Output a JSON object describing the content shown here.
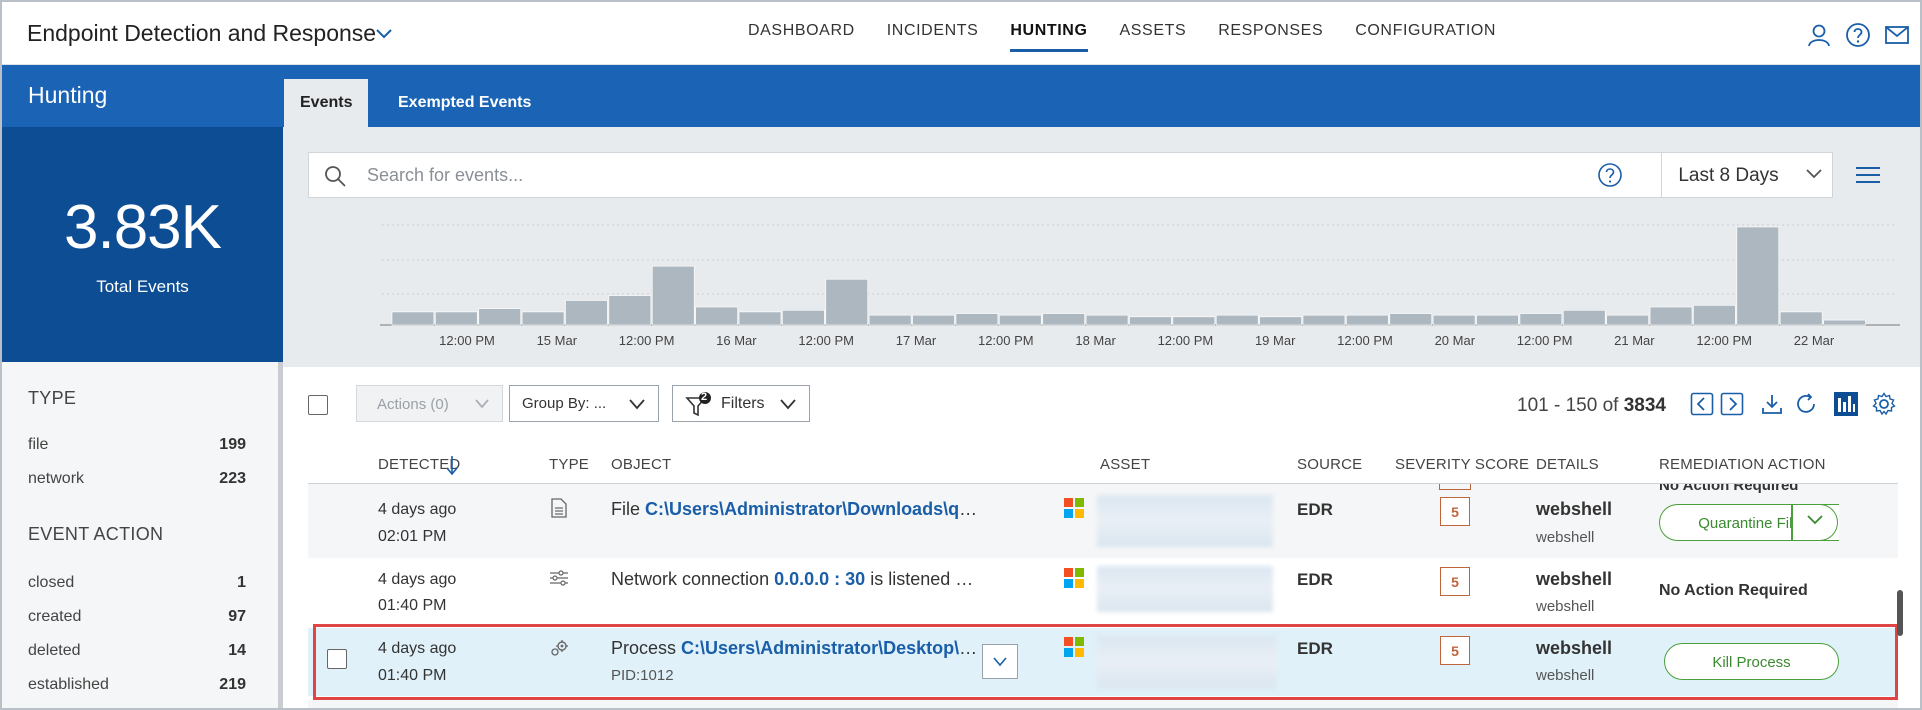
{
  "app": {
    "title": "Endpoint Detection and Response"
  },
  "topnav": [
    {
      "label": "DASHBOARD"
    },
    {
      "label": "INCIDENTS"
    },
    {
      "label": "HUNTING",
      "active": true
    },
    {
      "label": "ASSETS"
    },
    {
      "label": "RESPONSES"
    },
    {
      "label": "CONFIGURATION"
    }
  ],
  "sidebar": {
    "title": "Hunting",
    "total_value": "3.83K",
    "total_label": "Total Events",
    "type_heading": "TYPE",
    "types": [
      {
        "label": "file",
        "count": "199"
      },
      {
        "label": "network",
        "count": "223"
      }
    ],
    "event_action_heading": "EVENT ACTION",
    "event_actions": [
      {
        "label": "closed",
        "count": "1"
      },
      {
        "label": "created",
        "count": "97"
      },
      {
        "label": "deleted",
        "count": "14"
      },
      {
        "label": "established",
        "count": "219"
      }
    ]
  },
  "tabs": [
    {
      "label": "Events",
      "active": true
    },
    {
      "label": "Exempted Events"
    }
  ],
  "search": {
    "placeholder": "Search for events...",
    "value": ""
  },
  "date_range": {
    "selected": "Last 8 Days"
  },
  "histogram": {
    "values": [
      8,
      8,
      10,
      8,
      15,
      18,
      36,
      11,
      8,
      9,
      28,
      6,
      6,
      7,
      6,
      7,
      6,
      5,
      5,
      6,
      5,
      6,
      6,
      7,
      6,
      6,
      7,
      9,
      6,
      11,
      12,
      60,
      8,
      3
    ],
    "x_labels": [
      "12:00 PM",
      "15 Mar",
      "12:00 PM",
      "16 Mar",
      "12:00 PM",
      "17 Mar",
      "12:00 PM",
      "18 Mar",
      "12:00 PM",
      "19 Mar",
      "12:00 PM",
      "20 Mar",
      "12:00 PM",
      "21 Mar",
      "12:00 PM",
      "22 Mar"
    ],
    "bar_color": "#adb7bf"
  },
  "toolbar": {
    "actions_label": "Actions (0)",
    "group_by_label": "Group By: ...",
    "filters_label": "Filters",
    "filters_badge": "2",
    "range": "101 - 150 of",
    "total": "3834"
  },
  "table": {
    "headers": {
      "detected": "DETECTED",
      "type": "TYPE",
      "object": "OBJECT",
      "asset": "ASSET",
      "source": "SOURCE",
      "severity": "SEVERITY SCORE",
      "details": "DETAILS",
      "remediation": "REMEDIATION ACTION"
    },
    "partial_top_remediation": "No Action Required",
    "rows": [
      {
        "when": "4 days ago",
        "time": "02:01 PM",
        "type_icon": "file-icon",
        "object_prefix": "File",
        "object_path": "C:\\Users\\Administrator\\Downloads\\qn…",
        "object_suffix": "",
        "source": "EDR",
        "severity": "5",
        "detail": "webshell",
        "detail_sub": "webshell",
        "remediation": "Quarantine File",
        "remediation_type": "button-with-dropdown"
      },
      {
        "when": "4 days ago",
        "time": "01:40 PM",
        "type_icon": "network-icon",
        "object_prefix": "Network connection",
        "object_path": "0.0.0.0 : 30",
        "object_suffix": "is listened …",
        "source": "EDR",
        "severity": "5",
        "detail": "webshell",
        "detail_sub": "webshell",
        "remediation": "No Action Required",
        "remediation_type": "text"
      },
      {
        "when": "4 days ago",
        "time": "01:40 PM",
        "type_icon": "process-gear-icon",
        "object_prefix": "Process",
        "object_path": "C:\\Users\\Administrator\\Desktop\\q…",
        "object_suffix": "",
        "object_sub": "PID:1012",
        "source": "EDR",
        "severity": "5",
        "detail": "webshell",
        "detail_sub": "webshell",
        "remediation": "Kill Process",
        "remediation_type": "button",
        "selected": true
      }
    ]
  },
  "colors": {
    "brand_blue": "#1a63b5",
    "dark_blue": "#0d4d94",
    "link_blue": "#1a5ea8",
    "severity": "#c0643c",
    "action_green": "#4aa03b",
    "highlight_red": "#e04545"
  }
}
